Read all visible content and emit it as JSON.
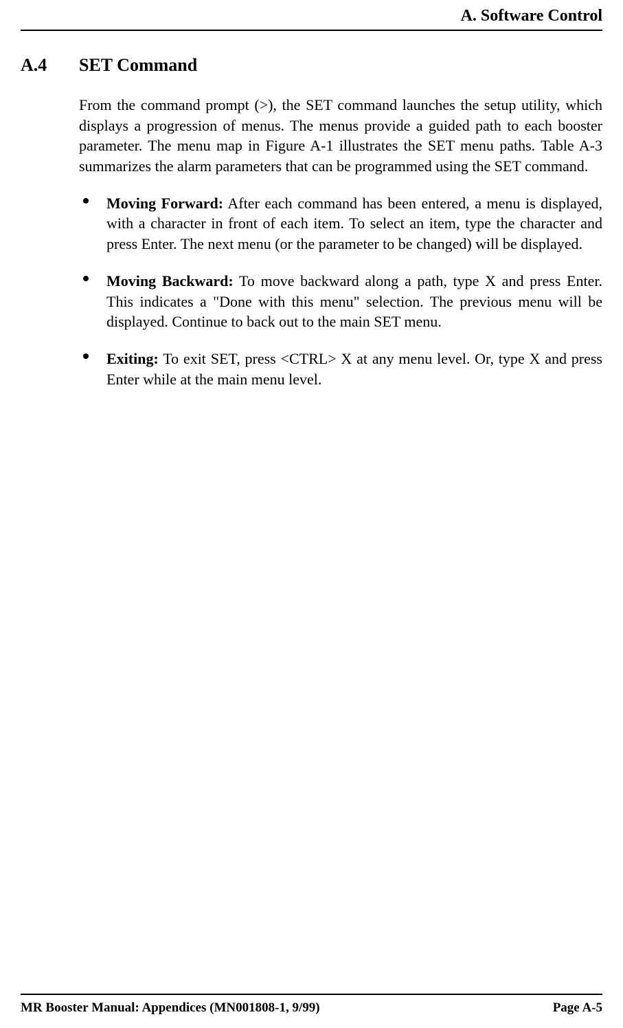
{
  "header": {
    "title": "A. Software Control"
  },
  "section": {
    "number": "A.4",
    "title": "SET Command",
    "intro": "From the command prompt (>), the SET command launches the setup utility, which displays a progression of menus.  The menus provide a guided path to each booster parameter.  The menu map in Figure A-1 illustrates the SET menu paths. Table A-3 summarizes the alarm parameters that can be programmed using the SET command.",
    "bullets": [
      {
        "label": "Moving Forward:",
        "text": " After each command has been entered, a menu is displayed, with a character in front of each item.  To select an item, type the character and press Enter.  The next menu (or the parameter to be changed) will be displayed."
      },
      {
        "label": "Moving Backward:",
        "text": " To move backward along a path, type X and press Enter. This indicates a \"Done with this menu\" selection. The previous menu will be displayed.  Continue to back out to the main SET menu."
      },
      {
        "label": "Exiting:",
        "text": " To exit SET, press <CTRL> X at any menu level.  Or, type X and press Enter while at the main menu level."
      }
    ]
  },
  "footer": {
    "left": "MR Booster Manual: Appendices (MN001808-1, 9/99)",
    "right": "Page A-5"
  }
}
